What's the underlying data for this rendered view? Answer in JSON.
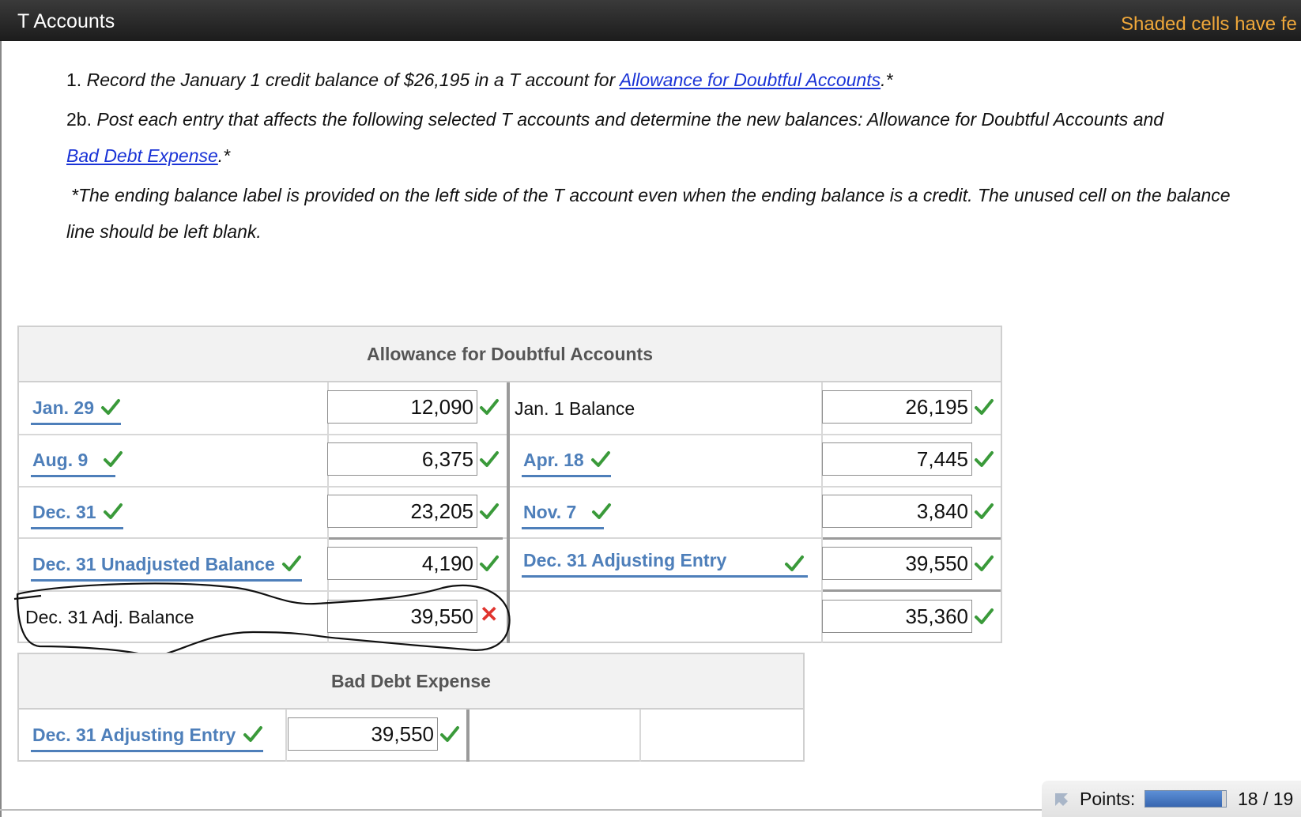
{
  "window": {
    "title": "T Accounts",
    "hint": "Shaded cells have fe"
  },
  "instructions": {
    "item1": {
      "number": "1.",
      "text": "Record the January 1 credit balance of $26,195 in a T account for",
      "link": "Allowance for Doubtful Accounts",
      "suffix": ".*"
    },
    "item2b": {
      "number": "2b.",
      "text": "Post each entry that affects the following selected T accounts and determine the new balances: Allowance for Doubtful Accounts and",
      "link": "Bad Debt Expense",
      "suffix": ".*"
    },
    "note_line1": "*The ending balance label is provided on the left side of the T account even when the ending balance is a credit. The unused cell on the balance",
    "note_line2": "line should be left blank."
  },
  "allowance_account": {
    "title": "Allowance for Doubtful Accounts",
    "rows": [
      {
        "left_label": "Jan. 29",
        "left_amount": "12,090",
        "right_label": "Jan. 1 Balance",
        "right_amount": "26,195"
      },
      {
        "left_label": "Aug. 9",
        "left_amount": "6,375",
        "right_label": "Apr. 18",
        "right_amount": "7,445"
      },
      {
        "left_label": "Dec. 31",
        "left_amount": "23,205",
        "right_label": "Nov. 7",
        "right_amount": "3,840"
      },
      {
        "left_label": "Dec. 31 Unadjusted Balance",
        "left_amount": "4,190",
        "right_label": "Dec. 31 Adjusting Entry",
        "right_amount": "39,550"
      },
      {
        "left_label": "Dec. 31 Adj. Balance",
        "left_amount": "39,550",
        "right_label": "",
        "right_amount": "35,360"
      }
    ],
    "left_amount_status": [
      "correct",
      "correct",
      "correct",
      "correct",
      "incorrect"
    ],
    "right_amount_status": [
      "correct",
      "correct",
      "correct",
      "correct",
      "correct"
    ]
  },
  "bad_debt_account": {
    "title": "Bad Debt Expense",
    "left_label": "Dec. 31 Adjusting Entry",
    "left_amount": "39,550"
  },
  "points": {
    "label": "Points:",
    "value": "18 / 19",
    "fraction": 0.947
  },
  "colors": {
    "link": "#1a33d6",
    "account_label": "#4e7fba",
    "check": "#3a9a3a",
    "cross": "#e0342e",
    "hint": "#f0a83a"
  },
  "icons": [
    "check-icon",
    "cross-icon",
    "points-arrow-icon"
  ]
}
